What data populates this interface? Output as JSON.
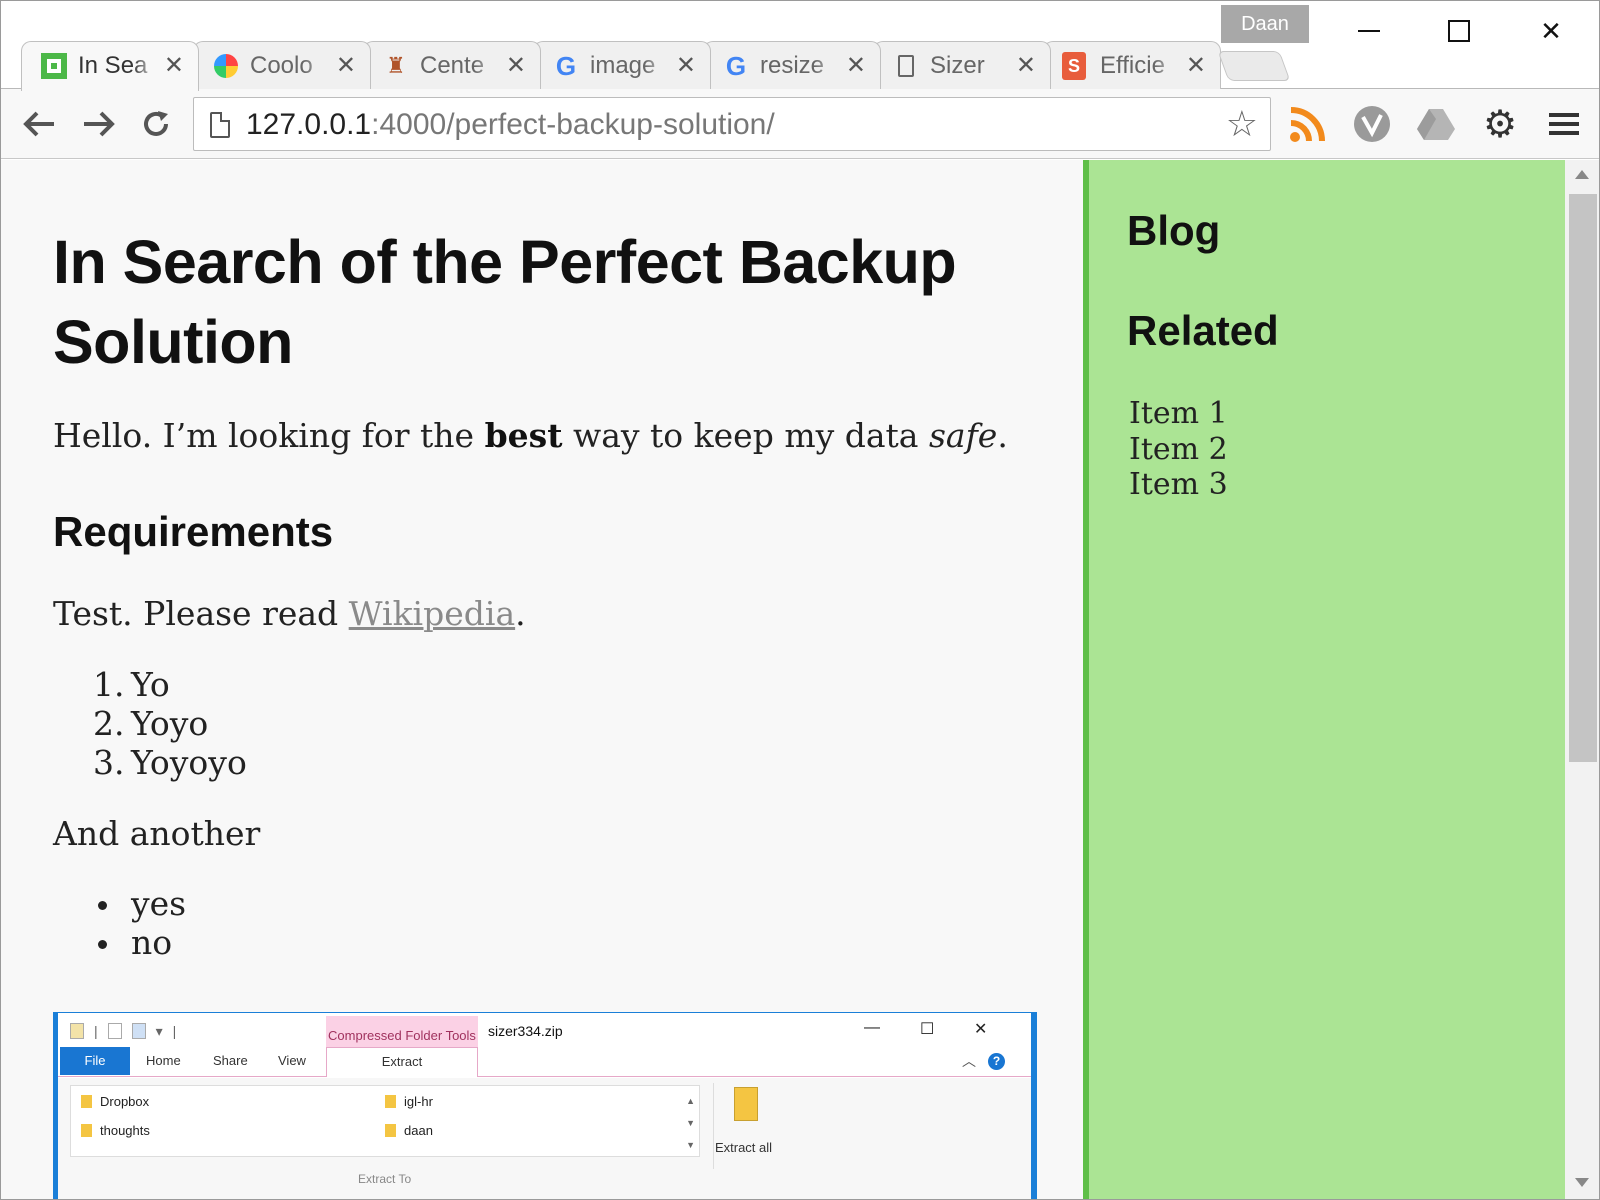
{
  "browser": {
    "profile_name": "Daan",
    "tabs": [
      {
        "title": "In Search of the Perfect Backup Solution",
        "short": "In Sea",
        "icon": "green-square-icon"
      },
      {
        "title": "Coolors",
        "short": "Coolo",
        "icon": "color-wheel-icon"
      },
      {
        "title": "Center",
        "short": "Cente",
        "icon": "can-i-use-icon"
      },
      {
        "title": "image",
        "short": "image",
        "icon": "google-icon"
      },
      {
        "title": "resize",
        "short": "resize",
        "icon": "google-icon"
      },
      {
        "title": "Sizer",
        "short": "Sizer",
        "icon": "page-icon"
      },
      {
        "title": "Efficient",
        "short": "Efficie",
        "icon": "s-logo-icon"
      }
    ],
    "url_host": "127.0.0.1",
    "url_path": ":4000/perfect-backup-solution/",
    "extensions": [
      "rss-icon",
      "vivaldi-icon",
      "drive-icon",
      "gear-icon",
      "menu-icon"
    ]
  },
  "article": {
    "title": "In Search of the Perfect Backup Solution",
    "intro": {
      "before": "Hello. I’m looking for the ",
      "bold": "best",
      "middle": " way to keep my data ",
      "italic": "safe",
      "after": "."
    },
    "requirements_heading": "Requirements",
    "test_para": {
      "before": "Test. Please read ",
      "link": "Wikipedia",
      "after": "."
    },
    "ordered_list": [
      {
        "num": "1.",
        "text": "Yo"
      },
      {
        "num": "2.",
        "text": "Yoyo"
      },
      {
        "num": "3.",
        "text": "Yoyoyo"
      }
    ],
    "and_another": "And another",
    "bullet_list": [
      "yes",
      "no"
    ],
    "screenshot": {
      "context_tab": "Compressed Folder Tools",
      "filename": "sizer334.zip",
      "ribbon_tabs": {
        "file": "File",
        "home": "Home",
        "share": "Share",
        "view": "View",
        "extract": "Extract"
      },
      "destinations": [
        "Dropbox",
        "thoughts",
        "igl-hr",
        "daan"
      ],
      "group_label": "Extract To",
      "extract_all": "Extract all"
    }
  },
  "sidebar": {
    "blog_heading": "Blog",
    "related_heading": "Related",
    "items": [
      "Item 1",
      "Item 2",
      "Item 3"
    ]
  },
  "colors": {
    "sidebar_bg": "#abe494",
    "sidebar_border": "#5fbf48",
    "link": "#8a8a8a",
    "page_bg": "#f8f8f8"
  }
}
